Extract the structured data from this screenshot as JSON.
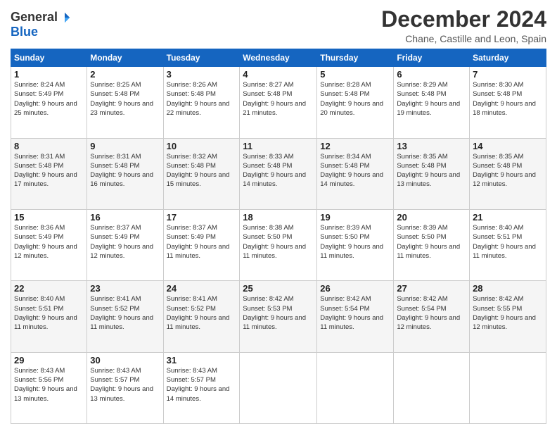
{
  "logo": {
    "general": "General",
    "blue": "Blue"
  },
  "title": "December 2024",
  "location": "Chane, Castille and Leon, Spain",
  "days_header": [
    "Sunday",
    "Monday",
    "Tuesday",
    "Wednesday",
    "Thursday",
    "Friday",
    "Saturday"
  ],
  "weeks": [
    [
      {
        "day": "1",
        "sunrise": "Sunrise: 8:24 AM",
        "sunset": "Sunset: 5:49 PM",
        "daylight": "Daylight: 9 hours and 25 minutes."
      },
      {
        "day": "2",
        "sunrise": "Sunrise: 8:25 AM",
        "sunset": "Sunset: 5:48 PM",
        "daylight": "Daylight: 9 hours and 23 minutes."
      },
      {
        "day": "3",
        "sunrise": "Sunrise: 8:26 AM",
        "sunset": "Sunset: 5:48 PM",
        "daylight": "Daylight: 9 hours and 22 minutes."
      },
      {
        "day": "4",
        "sunrise": "Sunrise: 8:27 AM",
        "sunset": "Sunset: 5:48 PM",
        "daylight": "Daylight: 9 hours and 21 minutes."
      },
      {
        "day": "5",
        "sunrise": "Sunrise: 8:28 AM",
        "sunset": "Sunset: 5:48 PM",
        "daylight": "Daylight: 9 hours and 20 minutes."
      },
      {
        "day": "6",
        "sunrise": "Sunrise: 8:29 AM",
        "sunset": "Sunset: 5:48 PM",
        "daylight": "Daylight: 9 hours and 19 minutes."
      },
      {
        "day": "7",
        "sunrise": "Sunrise: 8:30 AM",
        "sunset": "Sunset: 5:48 PM",
        "daylight": "Daylight: 9 hours and 18 minutes."
      }
    ],
    [
      {
        "day": "8",
        "sunrise": "Sunrise: 8:31 AM",
        "sunset": "Sunset: 5:48 PM",
        "daylight": "Daylight: 9 hours and 17 minutes."
      },
      {
        "day": "9",
        "sunrise": "Sunrise: 8:31 AM",
        "sunset": "Sunset: 5:48 PM",
        "daylight": "Daylight: 9 hours and 16 minutes."
      },
      {
        "day": "10",
        "sunrise": "Sunrise: 8:32 AM",
        "sunset": "Sunset: 5:48 PM",
        "daylight": "Daylight: 9 hours and 15 minutes."
      },
      {
        "day": "11",
        "sunrise": "Sunrise: 8:33 AM",
        "sunset": "Sunset: 5:48 PM",
        "daylight": "Daylight: 9 hours and 14 minutes."
      },
      {
        "day": "12",
        "sunrise": "Sunrise: 8:34 AM",
        "sunset": "Sunset: 5:48 PM",
        "daylight": "Daylight: 9 hours and 14 minutes."
      },
      {
        "day": "13",
        "sunrise": "Sunrise: 8:35 AM",
        "sunset": "Sunset: 5:48 PM",
        "daylight": "Daylight: 9 hours and 13 minutes."
      },
      {
        "day": "14",
        "sunrise": "Sunrise: 8:35 AM",
        "sunset": "Sunset: 5:48 PM",
        "daylight": "Daylight: 9 hours and 12 minutes."
      }
    ],
    [
      {
        "day": "15",
        "sunrise": "Sunrise: 8:36 AM",
        "sunset": "Sunset: 5:49 PM",
        "daylight": "Daylight: 9 hours and 12 minutes."
      },
      {
        "day": "16",
        "sunrise": "Sunrise: 8:37 AM",
        "sunset": "Sunset: 5:49 PM",
        "daylight": "Daylight: 9 hours and 12 minutes."
      },
      {
        "day": "17",
        "sunrise": "Sunrise: 8:37 AM",
        "sunset": "Sunset: 5:49 PM",
        "daylight": "Daylight: 9 hours and 11 minutes."
      },
      {
        "day": "18",
        "sunrise": "Sunrise: 8:38 AM",
        "sunset": "Sunset: 5:50 PM",
        "daylight": "Daylight: 9 hours and 11 minutes."
      },
      {
        "day": "19",
        "sunrise": "Sunrise: 8:39 AM",
        "sunset": "Sunset: 5:50 PM",
        "daylight": "Daylight: 9 hours and 11 minutes."
      },
      {
        "day": "20",
        "sunrise": "Sunrise: 8:39 AM",
        "sunset": "Sunset: 5:50 PM",
        "daylight": "Daylight: 9 hours and 11 minutes."
      },
      {
        "day": "21",
        "sunrise": "Sunrise: 8:40 AM",
        "sunset": "Sunset: 5:51 PM",
        "daylight": "Daylight: 9 hours and 11 minutes."
      }
    ],
    [
      {
        "day": "22",
        "sunrise": "Sunrise: 8:40 AM",
        "sunset": "Sunset: 5:51 PM",
        "daylight": "Daylight: 9 hours and 11 minutes."
      },
      {
        "day": "23",
        "sunrise": "Sunrise: 8:41 AM",
        "sunset": "Sunset: 5:52 PM",
        "daylight": "Daylight: 9 hours and 11 minutes."
      },
      {
        "day": "24",
        "sunrise": "Sunrise: 8:41 AM",
        "sunset": "Sunset: 5:52 PM",
        "daylight": "Daylight: 9 hours and 11 minutes."
      },
      {
        "day": "25",
        "sunrise": "Sunrise: 8:42 AM",
        "sunset": "Sunset: 5:53 PM",
        "daylight": "Daylight: 9 hours and 11 minutes."
      },
      {
        "day": "26",
        "sunrise": "Sunrise: 8:42 AM",
        "sunset": "Sunset: 5:54 PM",
        "daylight": "Daylight: 9 hours and 11 minutes."
      },
      {
        "day": "27",
        "sunrise": "Sunrise: 8:42 AM",
        "sunset": "Sunset: 5:54 PM",
        "daylight": "Daylight: 9 hours and 12 minutes."
      },
      {
        "day": "28",
        "sunrise": "Sunrise: 8:42 AM",
        "sunset": "Sunset: 5:55 PM",
        "daylight": "Daylight: 9 hours and 12 minutes."
      }
    ],
    [
      {
        "day": "29",
        "sunrise": "Sunrise: 8:43 AM",
        "sunset": "Sunset: 5:56 PM",
        "daylight": "Daylight: 9 hours and 13 minutes."
      },
      {
        "day": "30",
        "sunrise": "Sunrise: 8:43 AM",
        "sunset": "Sunset: 5:57 PM",
        "daylight": "Daylight: 9 hours and 13 minutes."
      },
      {
        "day": "31",
        "sunrise": "Sunrise: 8:43 AM",
        "sunset": "Sunset: 5:57 PM",
        "daylight": "Daylight: 9 hours and 14 minutes."
      },
      null,
      null,
      null,
      null
    ]
  ]
}
